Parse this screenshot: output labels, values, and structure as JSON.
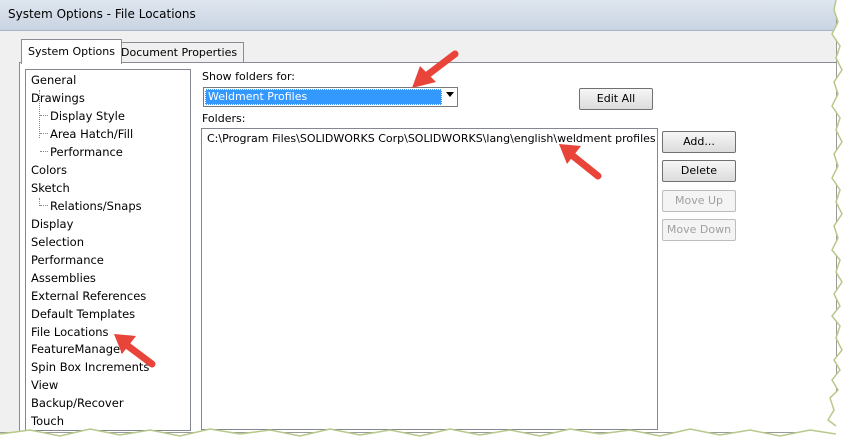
{
  "window": {
    "title": "System Options - File Locations"
  },
  "tabs": [
    {
      "label": "System Options",
      "active": true
    },
    {
      "label": "Document Properties",
      "active": false
    }
  ],
  "tree": [
    {
      "label": "General",
      "level": 0
    },
    {
      "label": "Drawings",
      "level": 0
    },
    {
      "label": "Display Style",
      "level": 1
    },
    {
      "label": "Area Hatch/Fill",
      "level": 1
    },
    {
      "label": "Performance",
      "level": 1
    },
    {
      "label": "Colors",
      "level": 0
    },
    {
      "label": "Sketch",
      "level": 0
    },
    {
      "label": "Relations/Snaps",
      "level": 1
    },
    {
      "label": "Display",
      "level": 0
    },
    {
      "label": "Selection",
      "level": 0
    },
    {
      "label": "Performance",
      "level": 0
    },
    {
      "label": "Assemblies",
      "level": 0
    },
    {
      "label": "External References",
      "level": 0
    },
    {
      "label": "Default Templates",
      "level": 0
    },
    {
      "label": "File Locations",
      "level": 0,
      "selected": true
    },
    {
      "label": "FeatureManager",
      "level": 0
    },
    {
      "label": "Spin Box Increments",
      "level": 0
    },
    {
      "label": "View",
      "level": 0
    },
    {
      "label": "Backup/Recover",
      "level": 0
    },
    {
      "label": "Touch",
      "level": 0
    }
  ],
  "show_folders": {
    "label": "Show folders for:",
    "selected": "Weldment Profiles"
  },
  "edit_all_label": "Edit All",
  "folders": {
    "label": "Folders:",
    "items": [
      "C:\\Program Files\\SOLIDWORKS Corp\\SOLIDWORKS\\lang\\english\\weldment profiles"
    ]
  },
  "buttons": {
    "add": "Add...",
    "delete": "Delete",
    "move_up": "Move Up",
    "move_down": "Move Down"
  },
  "colors": {
    "selection": "#3399ff",
    "annotation_arrow": "#e8443a"
  }
}
